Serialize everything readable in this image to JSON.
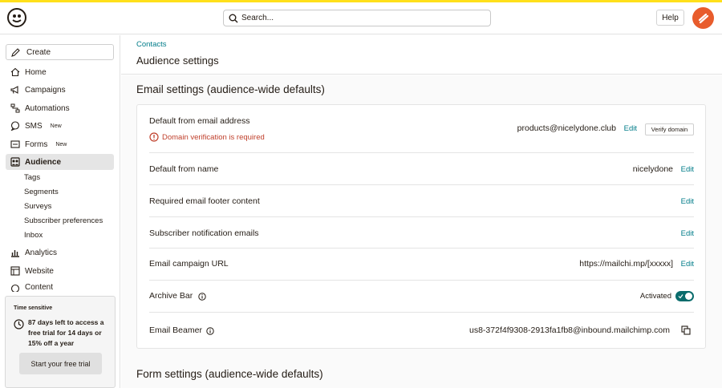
{
  "topbar": {
    "search_placeholder": "Search...",
    "help_label": "Help"
  },
  "sidebar": {
    "create_label": "Create",
    "items": [
      {
        "label": "Home",
        "icon": "home-icon"
      },
      {
        "label": "Campaigns",
        "icon": "megaphone-icon"
      },
      {
        "label": "Automations",
        "icon": "automation-icon"
      },
      {
        "label": "SMS",
        "icon": "chat-icon",
        "badge": "New"
      },
      {
        "label": "Forms",
        "icon": "form-icon",
        "badge": "New"
      },
      {
        "label": "Audience",
        "icon": "audience-icon",
        "active": true
      },
      {
        "label": "Analytics",
        "icon": "bar-chart-icon"
      },
      {
        "label": "Website",
        "icon": "website-icon"
      },
      {
        "label": "Content",
        "icon": "content-icon"
      }
    ],
    "audience_sub": [
      "Tags",
      "Segments",
      "Surveys",
      "Subscriber preferences",
      "Inbox"
    ],
    "trial": {
      "tag": "Time sensitive",
      "message": "87 days left to access a free trial for 14 days or 15% off a year",
      "button": "Start your free trial"
    }
  },
  "header": {
    "breadcrumb": "Contacts",
    "title": "Audience settings"
  },
  "main": {
    "email_section_title": "Email settings (audience-wide defaults)",
    "form_section_title": "Form settings (audience-wide defaults)",
    "rows": [
      {
        "label": "Default from email address",
        "value": "products@nicelydone.club",
        "edit": "Edit",
        "warning": "Domain verification is required",
        "verify": "Verify domain"
      },
      {
        "label": "Default from name",
        "value": "nicelydone",
        "edit": "Edit"
      },
      {
        "label": "Required email footer content",
        "value": "",
        "edit": "Edit"
      },
      {
        "label": "Subscriber notification emails",
        "value": "",
        "edit": "Edit"
      },
      {
        "label": "Email campaign URL",
        "value": "https://mailchi.mp/[xxxxx]",
        "edit": "Edit"
      },
      {
        "label": "Archive Bar",
        "value": "Activated",
        "toggle_on": true
      },
      {
        "label": "Email Beamer",
        "value": "us8-372f4f9308-2913fa1fb8@inbound.mailchimp.com"
      }
    ]
  },
  "colors": {
    "accent": "#007c89",
    "warning": "#c0402c",
    "toggle": "#0a6c6c",
    "brand_strip": "#ffe01b",
    "avatar": "#e85c2c"
  }
}
